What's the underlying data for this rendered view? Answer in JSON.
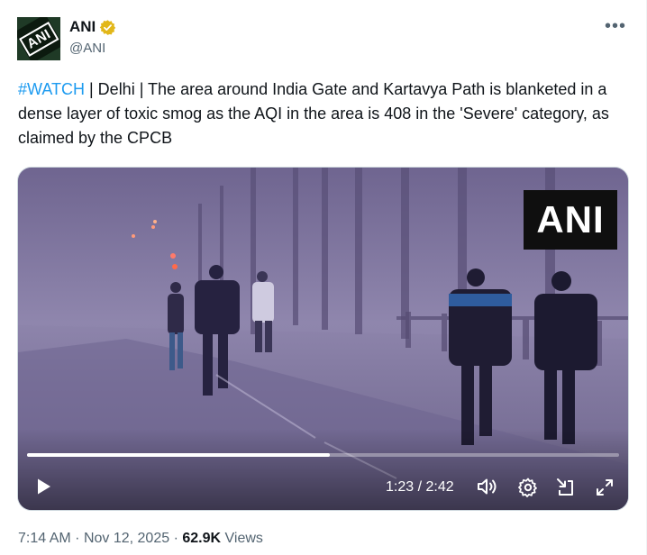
{
  "author": {
    "display_name": "ANI",
    "handle": "@ANI",
    "avatar_text": "ANI",
    "verified": true
  },
  "more_label": "•••",
  "tweet": {
    "hashtag": "#WATCH",
    "text": " | Delhi | The area around India Gate and Kartavya Path is blanketed in a dense layer of toxic smog as the AQI in the area is 408 in the 'Severe' category, as claimed by the CPCB"
  },
  "video": {
    "watermark": "ANI",
    "current_time": "1:23",
    "duration": "2:42",
    "time_display": "1:23 / 2:42",
    "progress_fraction": 0.512
  },
  "meta": {
    "time": "7:14 AM",
    "separator": "·",
    "date": "Nov 12, 2025",
    "views_count": "62.9K",
    "views_label": "Views"
  },
  "colors": {
    "link": "#1d9bf0",
    "secondary_text": "#536471",
    "verified_badge": "#e2b719",
    "smog": "#8a7fa6"
  }
}
